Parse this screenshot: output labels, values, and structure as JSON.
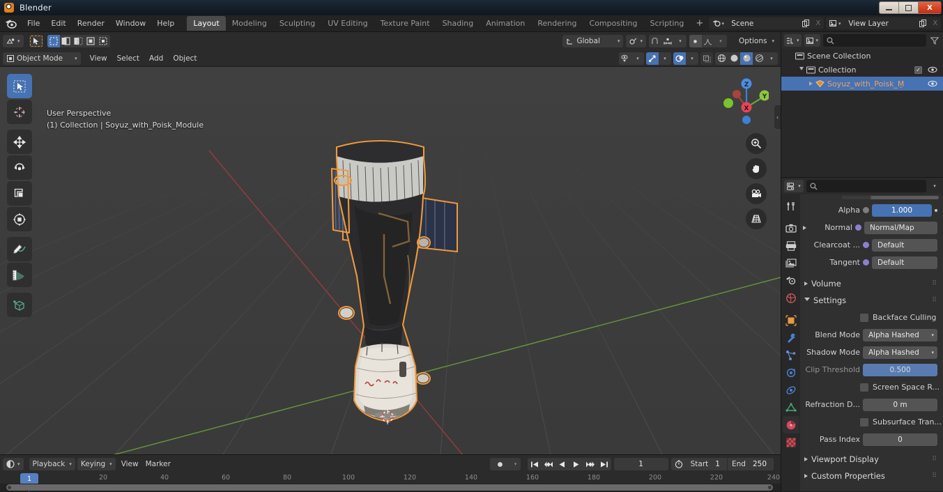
{
  "window": {
    "title": "Blender",
    "minimize_label": "minimize",
    "maximize_label": "maximize",
    "close_label": "X"
  },
  "topbar": {
    "menus": [
      "File",
      "Edit",
      "Render",
      "Window",
      "Help"
    ],
    "workspace_tabs": [
      {
        "label": "Layout",
        "active": true
      },
      {
        "label": "Modeling",
        "active": false
      },
      {
        "label": "Sculpting",
        "active": false
      },
      {
        "label": "UV Editing",
        "active": false
      },
      {
        "label": "Texture Paint",
        "active": false
      },
      {
        "label": "Shading",
        "active": false
      },
      {
        "label": "Animation",
        "active": false
      },
      {
        "label": "Rendering",
        "active": false
      },
      {
        "label": "Compositing",
        "active": false
      },
      {
        "label": "Scripting",
        "active": false
      }
    ],
    "add_tab_label": "+",
    "scene": {
      "name": "Scene",
      "new_label": "New",
      "unlink_label": "X"
    },
    "view_layer": {
      "name": "View Layer",
      "new_label": "New",
      "unlink_label": "X"
    }
  },
  "viewport": {
    "header": {
      "mode": "Object Mode",
      "menus": [
        "View",
        "Select",
        "Add",
        "Object"
      ],
      "transform_orientation": "Global",
      "options_label": "Options"
    },
    "overlay_text": {
      "line1": "User Perspective",
      "line2": "(1) Collection | Soyuz_with_Poisk_Module"
    },
    "gizmo_axes": [
      "Z",
      "Y",
      "X"
    ]
  },
  "tools": [
    {
      "name": "tweak-tool",
      "active": true
    },
    {
      "name": "cursor-tool",
      "active": false
    },
    {
      "name": "move-tool",
      "active": false
    },
    {
      "name": "rotate-tool",
      "active": false
    },
    {
      "name": "scale-tool",
      "active": false
    },
    {
      "name": "transform-tool",
      "active": false
    },
    {
      "name": "annotate-tool",
      "active": false
    },
    {
      "name": "measure-tool",
      "active": false
    },
    {
      "name": "add-cube-tool",
      "active": false
    }
  ],
  "outliner": {
    "search_placeholder": "",
    "rows": [
      {
        "label": "Scene Collection",
        "indent": 0,
        "selected": false,
        "has_checkbox": false,
        "has_eye": false,
        "expander": "none"
      },
      {
        "label": "Collection",
        "indent": 1,
        "selected": false,
        "has_checkbox": true,
        "has_eye": true,
        "expander": "open"
      },
      {
        "label": "Soyuz_with_Poisk_M̱",
        "indent": 2,
        "selected": true,
        "has_checkbox": false,
        "has_eye": true,
        "expander": "closed"
      }
    ]
  },
  "properties": {
    "search_placeholder": "",
    "tabs": [
      "tool-properties-tab",
      "render-properties-tab",
      "output-properties-tab",
      "view-layer-properties-tab",
      "scene-properties-tab",
      "world-properties-tab",
      "object-properties-tab",
      "modifier-properties-tab",
      "particles-properties-tab",
      "physics-properties-tab",
      "object-constraint-properties-tab",
      "object-data-properties-tab",
      "material-properties-tab",
      "texture-properties-tab"
    ],
    "active_tab_index": 12,
    "rows": [
      {
        "type": "value",
        "label": "Alpha",
        "value": "1.000",
        "style": "blue",
        "has_dot": true,
        "has_anim_dot": true
      },
      {
        "type": "value",
        "label": "Normal",
        "value": "Normal/Map",
        "style": "plain",
        "has_dot": true,
        "dot_color": "purple",
        "expander": "closed",
        "align": "left"
      },
      {
        "type": "value",
        "label": "Clearcoat ...",
        "value": "Default",
        "style": "plain",
        "has_dot": true,
        "dot_color": "purple",
        "align": "left"
      },
      {
        "type": "value",
        "label": "Tangent",
        "value": "Default",
        "style": "plain",
        "has_dot": true,
        "dot_color": "purple",
        "align": "left"
      },
      {
        "type": "section",
        "label": "Volume",
        "open": false
      },
      {
        "type": "section",
        "label": "Settings",
        "open": true
      },
      {
        "type": "checkbox",
        "label": "Backface Culling",
        "checked": false
      },
      {
        "type": "dropdown",
        "label": "Blend Mode",
        "value": "Alpha Hashed"
      },
      {
        "type": "dropdown",
        "label": "Shadow Mode",
        "value": "Alpha Hashed"
      },
      {
        "type": "value",
        "label": "Clip Threshold",
        "value": "0.500",
        "style": "blue-soft",
        "dim_label": true
      },
      {
        "type": "checkbox",
        "label": "Screen Space R...",
        "checked": false
      },
      {
        "type": "value",
        "label": "Refraction D...",
        "value": "0 m",
        "style": "plain"
      },
      {
        "type": "checkbox",
        "label": "Subsurface Tran...",
        "checked": false
      },
      {
        "type": "value",
        "label": "Pass Index",
        "value": "0",
        "style": "plain"
      },
      {
        "type": "section",
        "label": "Viewport Display",
        "open": false
      },
      {
        "type": "section",
        "label": "Custom Properties",
        "open": false
      }
    ]
  },
  "timeline": {
    "editor_label": "Timeline",
    "menus": [
      "Playback",
      "Keying",
      "View",
      "Marker"
    ],
    "current_frame": "1",
    "start_label": "Start",
    "start_value": "1",
    "end_label": "End",
    "end_value": "250",
    "ticks": [
      20,
      40,
      60,
      80,
      100,
      120,
      140,
      160,
      180,
      200,
      220,
      240
    ],
    "playhead_frame": "1"
  },
  "colors": {
    "accent_blue": "#4772b3",
    "selection_orange": "#ed9a3c",
    "background": "#303030",
    "viewport_bg": "#3b3b3b",
    "header_bg": "#2b2b2b",
    "title_close": "#c22e12"
  }
}
